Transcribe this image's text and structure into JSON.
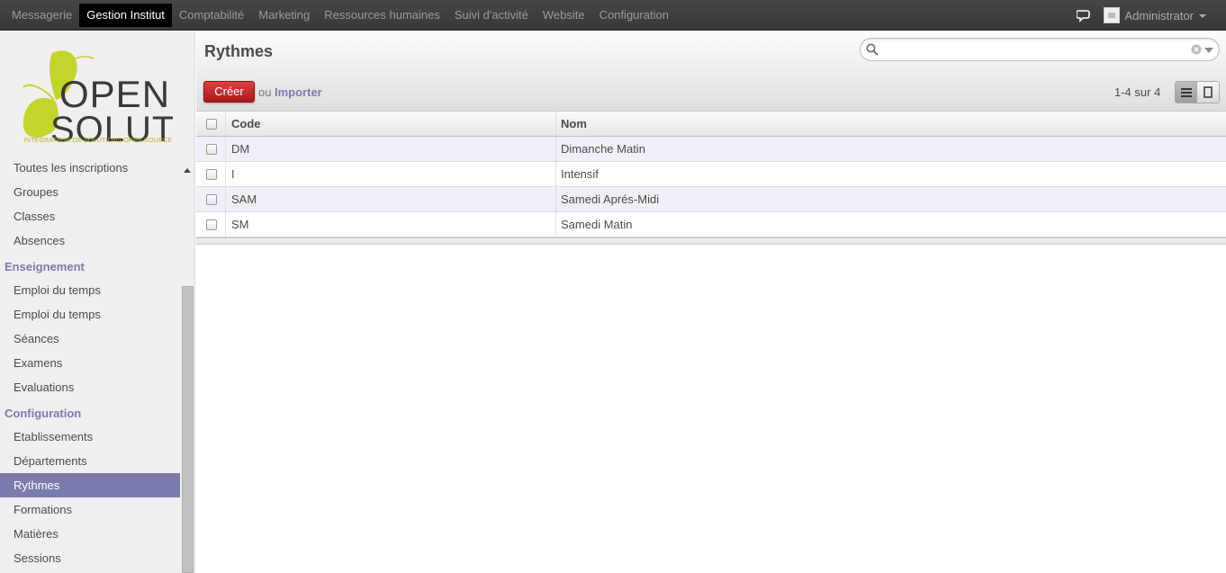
{
  "topmenu": {
    "items": [
      {
        "label": "Messagerie"
      },
      {
        "label": "Gestion Institut"
      },
      {
        "label": "Comptabilité"
      },
      {
        "label": "Marketing"
      },
      {
        "label": "Ressources humaines"
      },
      {
        "label": "Suivi d'activité"
      },
      {
        "label": "Website"
      },
      {
        "label": "Configuration"
      }
    ],
    "active_index": 1,
    "user": "Administrator"
  },
  "logo": {
    "text_line1": "OPEN",
    "text_line2": "SOLUTIS",
    "tagline": "INTEGRATEUR DE SOLUTIONS OPEN SOURCE",
    "color": "#c3d42c"
  },
  "sidebar": {
    "items": [
      {
        "label": "Toutes les inscriptions"
      },
      {
        "label": "Groupes"
      },
      {
        "label": "Classes"
      },
      {
        "label": "Absences"
      }
    ],
    "section_enseignement": "Enseignement",
    "enseignement_items": [
      {
        "label": "Emploi du temps"
      },
      {
        "label": "Emploi du temps"
      },
      {
        "label": "Séances"
      },
      {
        "label": "Examens"
      },
      {
        "label": "Evaluations"
      }
    ],
    "section_configuration": "Configuration",
    "configuration_items": [
      {
        "label": "Etablissements"
      },
      {
        "label": "Départements"
      },
      {
        "label": "Rythmes"
      },
      {
        "label": "Formations"
      },
      {
        "label": "Matières"
      },
      {
        "label": "Sessions"
      }
    ],
    "active_label": "Rythmes"
  },
  "main": {
    "title": "Rythmes",
    "search": {
      "value": "",
      "placeholder": ""
    },
    "create_label": "Créer",
    "or_label": "ou",
    "import_label": "Importer",
    "pager": "1-4 sur 4"
  },
  "table": {
    "headers": {
      "code": "Code",
      "name": "Nom"
    },
    "rows": [
      {
        "code": "DM",
        "name": "Dimanche Matin"
      },
      {
        "code": "I",
        "name": "Intensif"
      },
      {
        "code": "SAM",
        "name": "Samedi Aprés-Midi"
      },
      {
        "code": "SM",
        "name": "Samedi Matin"
      }
    ]
  },
  "colors": {
    "accent": "#7c7bad",
    "create_button": "#c0282c",
    "topbar": "#414141"
  }
}
